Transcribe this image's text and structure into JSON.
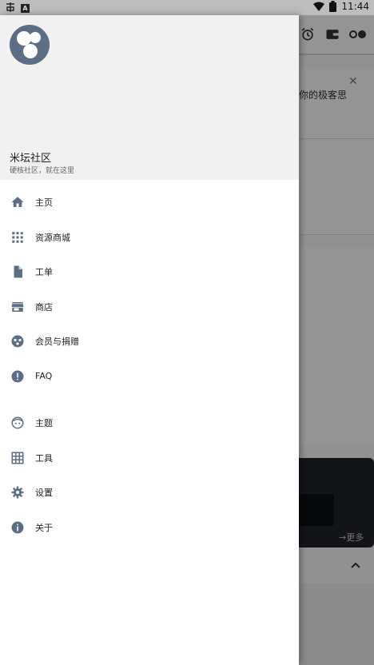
{
  "status_bar": {
    "time": "11:44"
  },
  "background": {
    "card_text": "你的极客思",
    "more_label": "→更多"
  },
  "drawer": {
    "header": {
      "title": "米坛社区",
      "subtitle": "硬核社区，就在这里"
    },
    "menu_items": [
      {
        "label": "主页",
        "icon": "home-icon"
      },
      {
        "label": "资源商城",
        "icon": "apps-grid-icon"
      },
      {
        "label": "工单",
        "icon": "document-icon"
      },
      {
        "label": "商店",
        "icon": "store-icon"
      },
      {
        "label": "会员与捐赠",
        "icon": "membership-icon"
      },
      {
        "label": "FAQ",
        "icon": "alert-icon"
      },
      {
        "label": "主题",
        "icon": "face-icon"
      },
      {
        "label": "工具",
        "icon": "table-grid-icon"
      },
      {
        "label": "设置",
        "icon": "gear-icon"
      },
      {
        "label": "关于",
        "icon": "info-icon"
      }
    ]
  },
  "colors": {
    "icon": "#5b6e86",
    "header_bg": "#f1f1f2",
    "banner": "#1f2328"
  }
}
